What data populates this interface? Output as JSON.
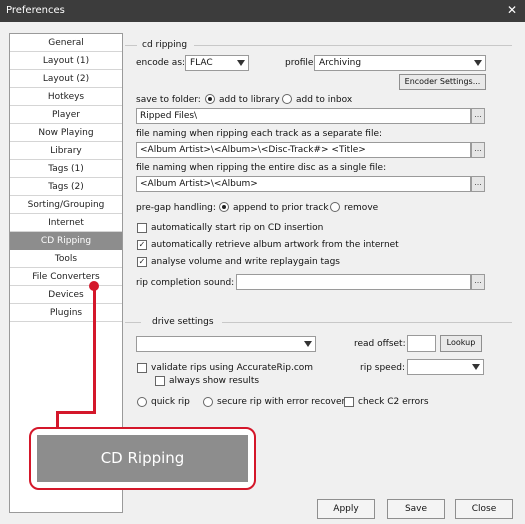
{
  "window": {
    "title": "Preferences",
    "close_glyph": "✕"
  },
  "sidebar": {
    "items": [
      {
        "label": "General"
      },
      {
        "label": "Layout (1)"
      },
      {
        "label": "Layout (2)"
      },
      {
        "label": "Hotkeys"
      },
      {
        "label": "Player"
      },
      {
        "label": "Now Playing"
      },
      {
        "label": "Library"
      },
      {
        "label": "Tags (1)"
      },
      {
        "label": "Tags (2)"
      },
      {
        "label": "Sorting/Grouping"
      },
      {
        "label": "Internet"
      },
      {
        "label": "CD Ripping",
        "selected": true
      },
      {
        "label": "Tools"
      },
      {
        "label": "File Converters"
      },
      {
        "label": "Devices"
      },
      {
        "label": "Plugins"
      }
    ]
  },
  "cd_ripping": {
    "section_title": "cd ripping",
    "encode_as_label": "encode as:",
    "encode_as_value": "FLAC",
    "profile_label": "profile:",
    "profile_value": "Archiving",
    "encoder_settings_button": "Encoder Settings...",
    "save_to_folder_label": "save to folder:",
    "add_to_library_label": "add to library",
    "add_to_inbox_label": "add to inbox",
    "save_folder_value": "Ripped Files\\",
    "naming_separate_label": "file naming when ripping each track as a separate file:",
    "naming_separate_value": "<Album Artist>\\<Album>\\<Disc-Track#> <Title>",
    "naming_single_label": "file naming when ripping the entire disc as a single file:",
    "naming_single_value": "<Album Artist>\\<Album>",
    "pregap_label": "pre-gap handling:",
    "pregap_append_label": "append to prior track",
    "pregap_remove_label": "remove",
    "auto_start_label": "automatically start rip on CD insertion",
    "auto_artwork_label": "automatically retrieve album artwork from the internet",
    "analyse_label": "analyse volume and write replaygain tags",
    "rip_sound_label": "rip completion sound:",
    "rip_sound_value": "",
    "dots": "..."
  },
  "drive": {
    "section_title": "drive settings",
    "drive_value": "",
    "read_offset_label": "read offset:",
    "read_offset_value": "",
    "lookup_button": "Lookup",
    "validate_label": "validate rips using AccurateRip.com",
    "always_show_label": "always show results",
    "rip_speed_label": "rip speed:",
    "rip_speed_value": "",
    "quick_rip_label": "quick rip",
    "secure_rip_label": "secure rip with error recovery",
    "check_c2_label": "check C2 errors"
  },
  "callout": {
    "label": "CD Ripping",
    "accent_color": "#d4172a"
  },
  "footer": {
    "apply": "Apply",
    "save": "Save",
    "close": "Close"
  }
}
